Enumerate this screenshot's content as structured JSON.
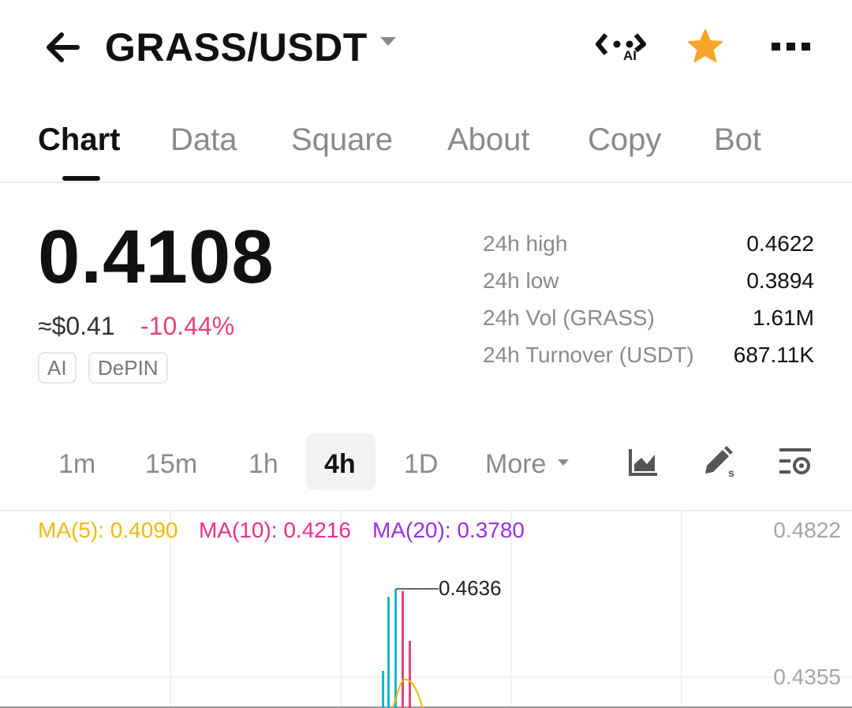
{
  "header": {
    "pair": "GRASS/USDT",
    "ai_label": "AI",
    "icons": [
      "back-arrow-icon",
      "chevron-down-icon",
      "ai-assistant-icon",
      "star-icon",
      "more-icon"
    ]
  },
  "tabs": [
    {
      "label": "Chart",
      "active": true
    },
    {
      "label": "Data"
    },
    {
      "label": "Square"
    },
    {
      "label": "About"
    },
    {
      "label": "Copy"
    },
    {
      "label": "Bot"
    }
  ],
  "price": {
    "last": "0.4108",
    "approx": "≈$0.41",
    "change": "-10.44%",
    "tags": [
      "AI",
      "DePIN"
    ]
  },
  "stats": [
    {
      "label": "24h high",
      "value": "0.4622"
    },
    {
      "label": "24h low",
      "value": "0.3894"
    },
    {
      "label": "24h Vol (GRASS)",
      "value": "1.61M"
    },
    {
      "label": "24h Turnover (USDT)",
      "value": "687.11K"
    }
  ],
  "intervals": {
    "items": [
      "1m",
      "15m",
      "1h",
      "4h",
      "1D",
      "More"
    ],
    "selected": "4h",
    "tools": [
      "chart-type-icon",
      "draw-icon",
      "indicator-settings-icon"
    ]
  },
  "chart": {
    "ma": [
      {
        "label": "MA(5): 0.4090",
        "color": "#f0b90b"
      },
      {
        "label": "MA(10): 0.4216",
        "color": "#e8308a"
      },
      {
        "label": "MA(20): 0.3780",
        "color": "#9b30e6"
      }
    ],
    "axis_labels": [
      "0.4822",
      "0.4355"
    ],
    "high_marker": "0.4636"
  },
  "colors": {
    "up": "#1fb5c8",
    "down": "#e8407a",
    "star": "#f7a52a"
  }
}
